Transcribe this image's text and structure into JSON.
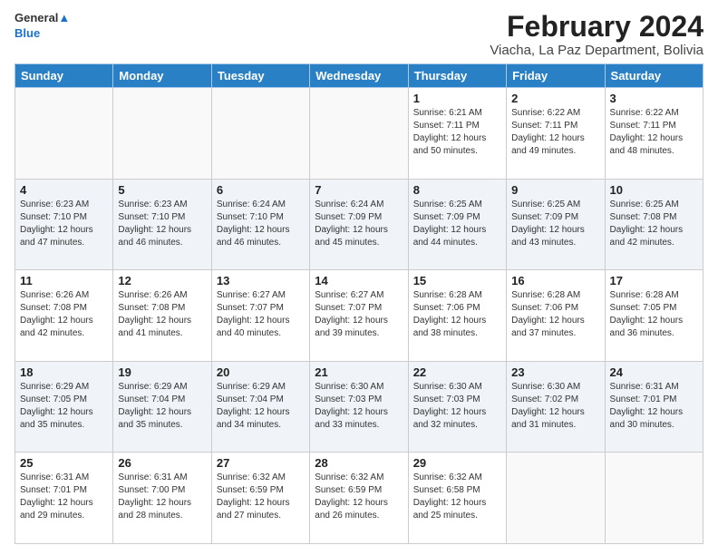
{
  "logo": {
    "line1": "General",
    "line2": "Blue"
  },
  "title": "February 2024",
  "subtitle": "Viacha, La Paz Department, Bolivia",
  "days_of_week": [
    "Sunday",
    "Monday",
    "Tuesday",
    "Wednesday",
    "Thursday",
    "Friday",
    "Saturday"
  ],
  "weeks": [
    {
      "shaded": false,
      "days": [
        {
          "num": "",
          "info": ""
        },
        {
          "num": "",
          "info": ""
        },
        {
          "num": "",
          "info": ""
        },
        {
          "num": "",
          "info": ""
        },
        {
          "num": "1",
          "info": "Sunrise: 6:21 AM\nSunset: 7:11 PM\nDaylight: 12 hours\nand 50 minutes."
        },
        {
          "num": "2",
          "info": "Sunrise: 6:22 AM\nSunset: 7:11 PM\nDaylight: 12 hours\nand 49 minutes."
        },
        {
          "num": "3",
          "info": "Sunrise: 6:22 AM\nSunset: 7:11 PM\nDaylight: 12 hours\nand 48 minutes."
        }
      ]
    },
    {
      "shaded": true,
      "days": [
        {
          "num": "4",
          "info": "Sunrise: 6:23 AM\nSunset: 7:10 PM\nDaylight: 12 hours\nand 47 minutes."
        },
        {
          "num": "5",
          "info": "Sunrise: 6:23 AM\nSunset: 7:10 PM\nDaylight: 12 hours\nand 46 minutes."
        },
        {
          "num": "6",
          "info": "Sunrise: 6:24 AM\nSunset: 7:10 PM\nDaylight: 12 hours\nand 46 minutes."
        },
        {
          "num": "7",
          "info": "Sunrise: 6:24 AM\nSunset: 7:09 PM\nDaylight: 12 hours\nand 45 minutes."
        },
        {
          "num": "8",
          "info": "Sunrise: 6:25 AM\nSunset: 7:09 PM\nDaylight: 12 hours\nand 44 minutes."
        },
        {
          "num": "9",
          "info": "Sunrise: 6:25 AM\nSunset: 7:09 PM\nDaylight: 12 hours\nand 43 minutes."
        },
        {
          "num": "10",
          "info": "Sunrise: 6:25 AM\nSunset: 7:08 PM\nDaylight: 12 hours\nand 42 minutes."
        }
      ]
    },
    {
      "shaded": false,
      "days": [
        {
          "num": "11",
          "info": "Sunrise: 6:26 AM\nSunset: 7:08 PM\nDaylight: 12 hours\nand 42 minutes."
        },
        {
          "num": "12",
          "info": "Sunrise: 6:26 AM\nSunset: 7:08 PM\nDaylight: 12 hours\nand 41 minutes."
        },
        {
          "num": "13",
          "info": "Sunrise: 6:27 AM\nSunset: 7:07 PM\nDaylight: 12 hours\nand 40 minutes."
        },
        {
          "num": "14",
          "info": "Sunrise: 6:27 AM\nSunset: 7:07 PM\nDaylight: 12 hours\nand 39 minutes."
        },
        {
          "num": "15",
          "info": "Sunrise: 6:28 AM\nSunset: 7:06 PM\nDaylight: 12 hours\nand 38 minutes."
        },
        {
          "num": "16",
          "info": "Sunrise: 6:28 AM\nSunset: 7:06 PM\nDaylight: 12 hours\nand 37 minutes."
        },
        {
          "num": "17",
          "info": "Sunrise: 6:28 AM\nSunset: 7:05 PM\nDaylight: 12 hours\nand 36 minutes."
        }
      ]
    },
    {
      "shaded": true,
      "days": [
        {
          "num": "18",
          "info": "Sunrise: 6:29 AM\nSunset: 7:05 PM\nDaylight: 12 hours\nand 35 minutes."
        },
        {
          "num": "19",
          "info": "Sunrise: 6:29 AM\nSunset: 7:04 PM\nDaylight: 12 hours\nand 35 minutes."
        },
        {
          "num": "20",
          "info": "Sunrise: 6:29 AM\nSunset: 7:04 PM\nDaylight: 12 hours\nand 34 minutes."
        },
        {
          "num": "21",
          "info": "Sunrise: 6:30 AM\nSunset: 7:03 PM\nDaylight: 12 hours\nand 33 minutes."
        },
        {
          "num": "22",
          "info": "Sunrise: 6:30 AM\nSunset: 7:03 PM\nDaylight: 12 hours\nand 32 minutes."
        },
        {
          "num": "23",
          "info": "Sunrise: 6:30 AM\nSunset: 7:02 PM\nDaylight: 12 hours\nand 31 minutes."
        },
        {
          "num": "24",
          "info": "Sunrise: 6:31 AM\nSunset: 7:01 PM\nDaylight: 12 hours\nand 30 minutes."
        }
      ]
    },
    {
      "shaded": false,
      "days": [
        {
          "num": "25",
          "info": "Sunrise: 6:31 AM\nSunset: 7:01 PM\nDaylight: 12 hours\nand 29 minutes."
        },
        {
          "num": "26",
          "info": "Sunrise: 6:31 AM\nSunset: 7:00 PM\nDaylight: 12 hours\nand 28 minutes."
        },
        {
          "num": "27",
          "info": "Sunrise: 6:32 AM\nSunset: 6:59 PM\nDaylight: 12 hours\nand 27 minutes."
        },
        {
          "num": "28",
          "info": "Sunrise: 6:32 AM\nSunset: 6:59 PM\nDaylight: 12 hours\nand 26 minutes."
        },
        {
          "num": "29",
          "info": "Sunrise: 6:32 AM\nSunset: 6:58 PM\nDaylight: 12 hours\nand 25 minutes."
        },
        {
          "num": "",
          "info": ""
        },
        {
          "num": "",
          "info": ""
        }
      ]
    }
  ]
}
